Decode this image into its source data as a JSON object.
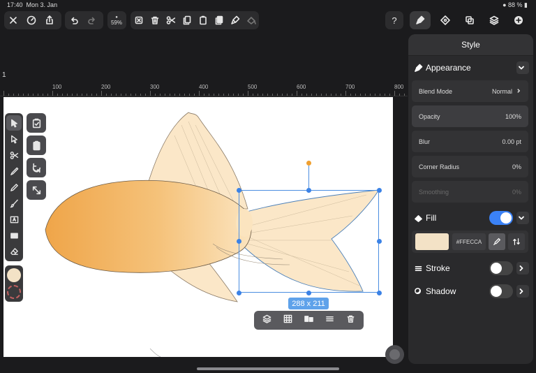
{
  "status": {
    "time": "17:40",
    "date": "Mon 3. Jan",
    "battery": "88 %"
  },
  "toolbar": {
    "zoom": "59%",
    "help": "?"
  },
  "ruler": {
    "corner": "1",
    "ticks": [
      "100",
      "200",
      "300",
      "400",
      "500",
      "600",
      "700",
      "800"
    ]
  },
  "selection": {
    "dimensions": "288 x 211"
  },
  "panel": {
    "title": "Style",
    "appearance": {
      "label": "Appearance",
      "blend_mode_label": "Blend Mode",
      "blend_mode_value": "Normal",
      "opacity_label": "Opacity",
      "opacity_value": "100%",
      "blur_label": "Blur",
      "blur_value": "0.00 pt",
      "corner_radius_label": "Corner Radius",
      "corner_radius_value": "0%",
      "smoothing_label": "Smoothing",
      "smoothing_value": "0%"
    },
    "fill": {
      "label": "Fill",
      "enabled": true,
      "hex": "#FFECCA",
      "color": "#FFECCA"
    },
    "stroke": {
      "label": "Stroke",
      "enabled": false
    },
    "shadow": {
      "label": "Shadow",
      "enabled": false
    }
  },
  "colors": {
    "accent": "#3b82f6",
    "fill_swatch": "#f3e2c6"
  }
}
